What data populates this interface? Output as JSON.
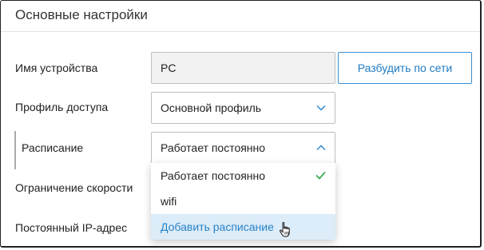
{
  "header": {
    "title": "Основные настройки"
  },
  "form": {
    "device_name": {
      "label": "Имя устройства",
      "value": "PC",
      "wake_button": "Разбудить по сети"
    },
    "access_profile": {
      "label": "Профиль доступа",
      "value": "Основной профиль"
    },
    "schedule": {
      "label": "Расписание",
      "value": "Работает постоянно",
      "options": [
        {
          "label": "Работает постоянно",
          "selected": true
        },
        {
          "label": "wifi",
          "selected": false
        },
        {
          "label": "Добавить расписание",
          "selected": false,
          "highlighted": true
        }
      ]
    },
    "speed_limit": {
      "label": "Ограничение скорости"
    },
    "static_ip": {
      "label": "Постоянный IP-адрес"
    }
  },
  "colors": {
    "accent": "#1f7bc4",
    "check": "#3fae5a",
    "highlight_bg": "#dcecf8"
  },
  "icons": [
    "chevron-down-icon",
    "chevron-up-icon",
    "checkmark-icon",
    "hand-pointer-cursor-icon"
  ]
}
